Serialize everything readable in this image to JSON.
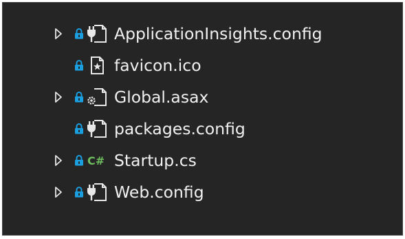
{
  "colors": {
    "background": "#252526",
    "text": "#f1f1f1",
    "lock": "#1a9fe0",
    "csharp": "#6fbf5f",
    "icon_stroke": "#e8e8e8"
  },
  "solution_explorer": {
    "items": [
      {
        "label": "ApplicationInsights.config",
        "expandable": true,
        "icon": "config-file-icon"
      },
      {
        "label": "favicon.ico",
        "expandable": false,
        "icon": "image-file-icon"
      },
      {
        "label": "Global.asax",
        "expandable": true,
        "icon": "asax-gear-file-icon"
      },
      {
        "label": "packages.config",
        "expandable": false,
        "icon": "config-file-icon"
      },
      {
        "label": "Startup.cs",
        "expandable": true,
        "icon": "csharp-file-icon"
      },
      {
        "label": "Web.config",
        "expandable": true,
        "icon": "config-file-icon"
      }
    ],
    "icon_texts": {
      "csharp": "C#"
    }
  }
}
